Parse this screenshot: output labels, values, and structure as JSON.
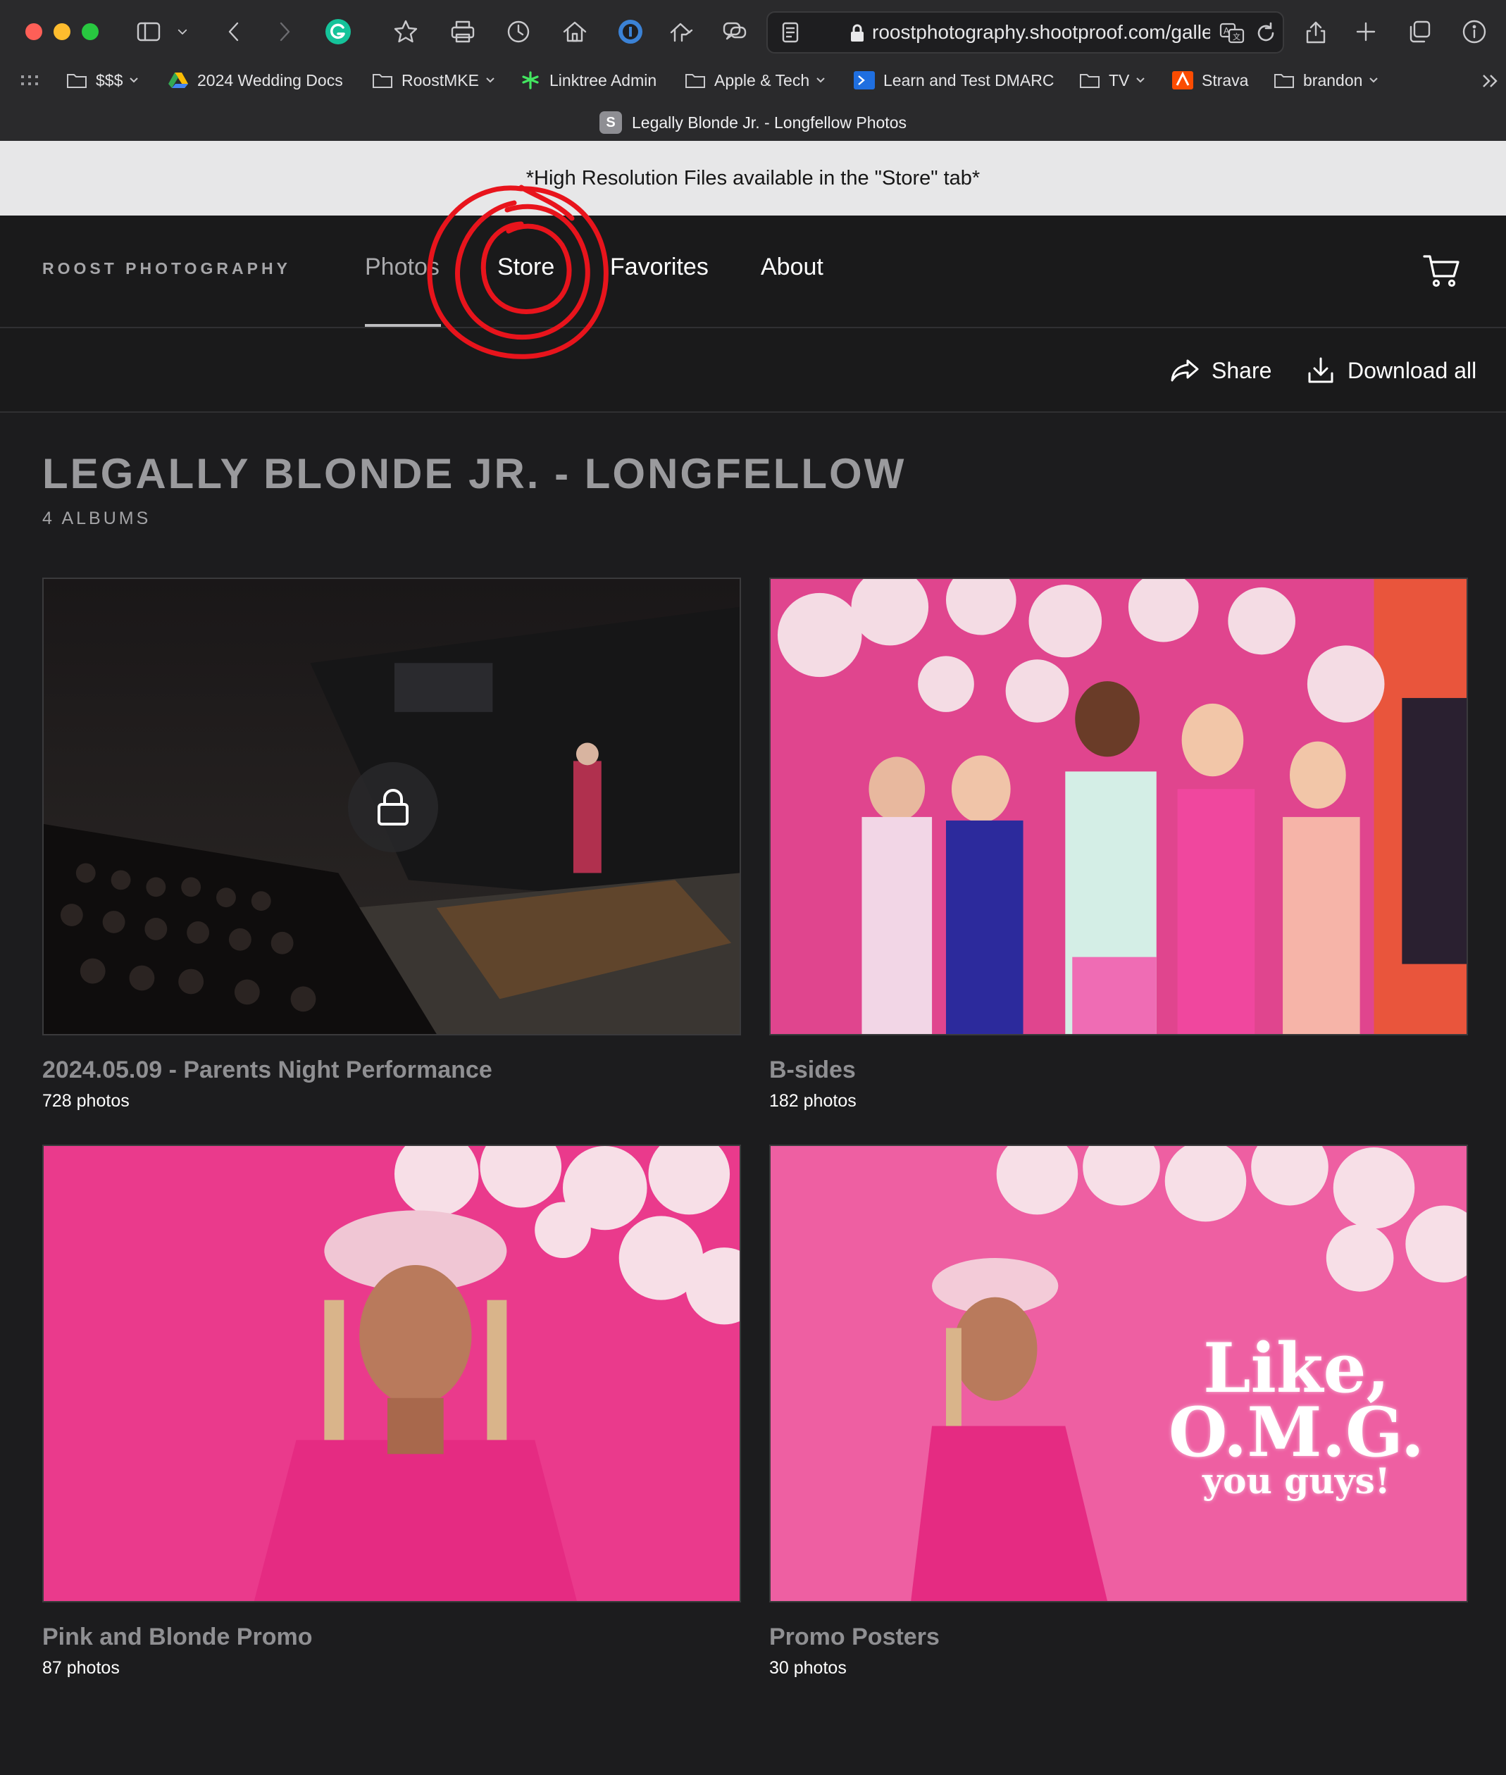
{
  "browser": {
    "url": "roostphotography.shootproof.com/galle",
    "tab_title": "Legally Blonde Jr. - Longfellow Photos",
    "tab_favicon_letter": "S",
    "bookmarks": [
      {
        "label": "$$$",
        "icon": "folder-icon",
        "has_menu": true
      },
      {
        "label": "2024 Wedding Docs",
        "icon": "google-drive-icon",
        "has_menu": false
      },
      {
        "label": "RoostMKE",
        "icon": "folder-icon",
        "has_menu": true
      },
      {
        "label": "Linktree Admin",
        "icon": "linktree-icon",
        "has_menu": false
      },
      {
        "label": "Apple & Tech",
        "icon": "folder-icon",
        "has_menu": true
      },
      {
        "label": "Learn and Test DMARC",
        "icon": "terminal-icon",
        "has_menu": false
      },
      {
        "label": "TV",
        "icon": "folder-icon",
        "has_menu": true
      },
      {
        "label": "Strava",
        "icon": "strava-icon",
        "has_menu": false
      },
      {
        "label": "brandon",
        "icon": "folder-icon",
        "has_menu": true
      }
    ]
  },
  "banner": {
    "text": "*High Resolution Files available in the \"Store\" tab*"
  },
  "nav": {
    "brand": "ROOST PHOTOGRAPHY",
    "links": [
      "Photos",
      "Store",
      "Favorites",
      "About"
    ],
    "active": "Photos"
  },
  "actions": {
    "share": "Share",
    "download_all": "Download all"
  },
  "gallery": {
    "title": "LEGALLY BLONDE JR. - LONGFELLOW",
    "subtitle": "4 ALBUMS",
    "albums": [
      {
        "name": "2024.05.09 - Parents Night Performance",
        "count": "728 photos",
        "locked": true
      },
      {
        "name": "B-sides",
        "count": "182 photos",
        "locked": false
      },
      {
        "name": "Pink and Blonde Promo",
        "count": "87 photos",
        "locked": false
      },
      {
        "name": "Promo Posters",
        "count": "30 photos",
        "locked": false
      }
    ],
    "poster_text": [
      "Like,",
      "O.M.G.",
      "you guys!"
    ]
  },
  "colors": {
    "annotation": "#e8141c",
    "page_bg": "#1c1c1e",
    "banner_bg": "#e7e7e8"
  }
}
